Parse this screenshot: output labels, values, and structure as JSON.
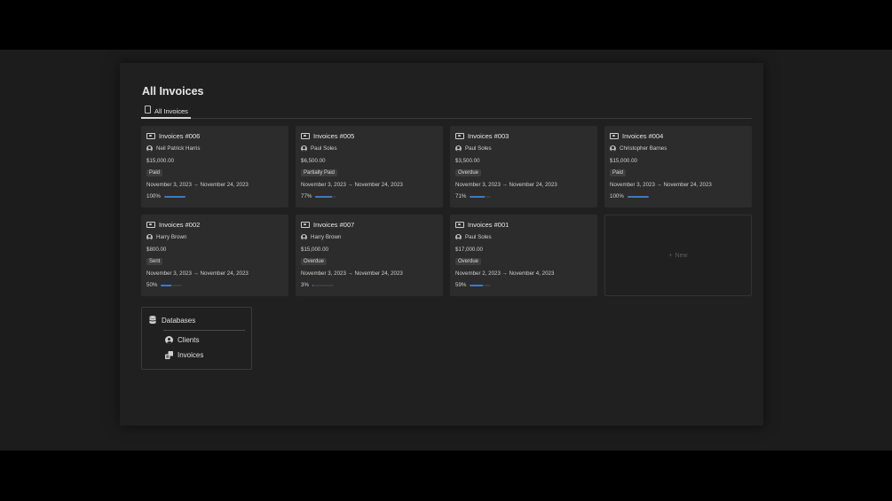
{
  "page": {
    "title": "All Invoices"
  },
  "tabs": [
    {
      "label": "All Invoices",
      "icon": "view-icon"
    }
  ],
  "cards": [
    {
      "title": "Invoices #006",
      "client": "Neil Patrick Harris",
      "amount": "$15,000.00",
      "status": "Paid",
      "dates": "November 3, 2023 → November 24, 2023",
      "progress_label": "100%",
      "progress": 1.0
    },
    {
      "title": "Invoices #005",
      "client": "Paul Soles",
      "amount": "$6,500.00",
      "status": "Partially Paid",
      "dates": "November 3, 2023 → November 24, 2023",
      "progress_label": "77%",
      "progress": 0.77
    },
    {
      "title": "Invoices #003",
      "client": "Paul Soles",
      "amount": "$3,500.00",
      "status": "Overdue",
      "dates": "November 3, 2023 → November 24, 2023",
      "progress_label": "71%",
      "progress": 0.71
    },
    {
      "title": "Invoices #004",
      "client": "Christopher Barnes",
      "amount": "$15,000.00",
      "status": "Paid",
      "dates": "November 3, 2023 → November 24, 2023",
      "progress_label": "100%",
      "progress": 1.0
    },
    {
      "title": "Invoices #002",
      "client": "Harry Brown",
      "amount": "$800.00",
      "status": "Sent",
      "dates": "November 3, 2023 → November 24, 2023",
      "progress_label": "50%",
      "progress": 0.5
    },
    {
      "title": "Invoices #007",
      "client": "Harry Brown",
      "amount": "$15,000.00",
      "status": "Overdue",
      "dates": "November 3, 2023 → November 24, 2023",
      "progress_label": "3%",
      "progress": 0.03
    },
    {
      "title": "Invoices #001",
      "client": "Paul Soles",
      "amount": "$17,000.00",
      "status": "Overdue",
      "dates": "November 2, 2023 → November 4, 2023",
      "progress_label": "59%",
      "progress": 0.59
    }
  ],
  "new_card": {
    "label": "New",
    "icon": "plus-icon"
  },
  "databases": {
    "title": "Databases",
    "icon": "database-icon",
    "items": [
      {
        "label": "Clients",
        "icon": "person-icon"
      },
      {
        "label": "Invoices",
        "icon": "invoices-db-icon"
      }
    ]
  },
  "colors": {
    "background": "#1c1c1c",
    "panel": "#202020",
    "card": "#2c2c2c",
    "progress_fill": "#3c7ac8",
    "progress_track": "#3c3c3c"
  }
}
